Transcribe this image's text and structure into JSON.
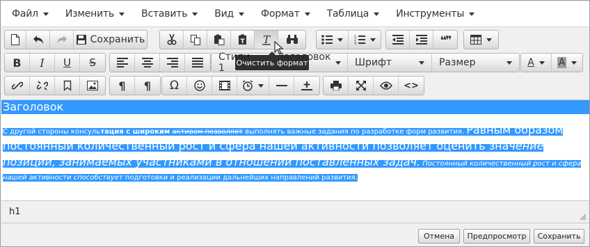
{
  "menubar": {
    "items": [
      "Файл",
      "Изменить",
      "Вставить",
      "Вид",
      "Формат",
      "Таблица",
      "Инструменты"
    ]
  },
  "toolbar": {
    "save_label": "Сохранить",
    "styles_label": "Стили",
    "format_label": "Заголовок 1",
    "font_label": "Шрифт",
    "size_label": "Размер",
    "font_color_letter": "A",
    "bg_color_letter": "A",
    "bold": "B",
    "italic": "I",
    "underline": "U",
    "strike": "S",
    "special_char": "Ω",
    "code": "<>",
    "pilcrow": "¶",
    "quote": "❝❞"
  },
  "tooltip": {
    "text": "Очистить формат"
  },
  "editor": {
    "heading": "Заголовок",
    "p_small_1": "С другой стороны консуль",
    "p_bold": "тация с широким",
    "p_space": " ",
    "p_strike": "активом позволяет",
    "p_small_2": " выполнять важные задания по разработке форм развития. ",
    "p_big_1": "Равным образом постоянный количественный рост и сфера нашей активности позволяет оценить зна",
    "p_big_italic": "чение позиций, занимаемых участниками в отношении поставленных задач.",
    "p_small_italic": " Постоянный количественный рост и сфера нашей активности способствует",
    "p_small_3": " подготовки и реализации дальнейших направлений развития."
  },
  "status": {
    "path": "h1"
  },
  "footer": {
    "cancel": "Отмена",
    "preview": "Предпросмотр",
    "save": "Сохранить"
  },
  "colors": {
    "selection": "#3399ff",
    "tooltip_bg": "#202020",
    "toolbar_bg": "#f0f0f0"
  }
}
